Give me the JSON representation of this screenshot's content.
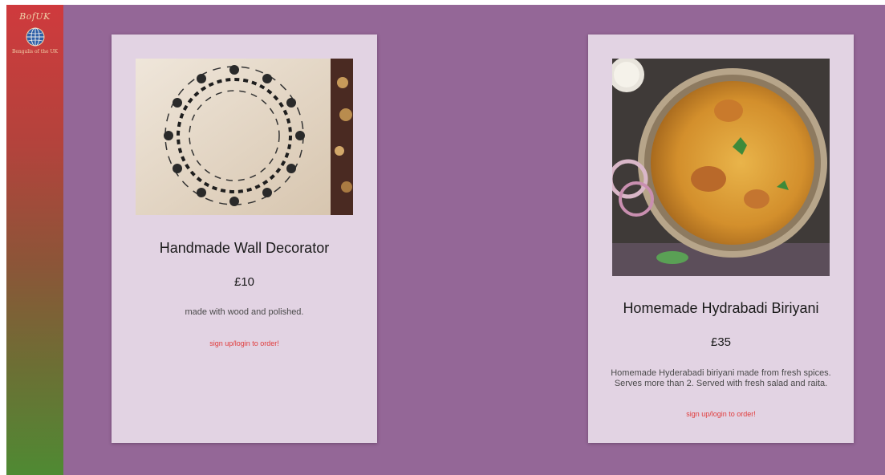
{
  "brand": {
    "logo_text": "BofUK",
    "logo_subtitle": "Bengalis of the UK"
  },
  "colors": {
    "background": "#946797",
    "card": "#e2d3e3",
    "cta": "#e03c3c",
    "sidebar_top": "#cf3a3d",
    "sidebar_bottom": "#4f8a33"
  },
  "products": [
    {
      "image": "wall-decor-image",
      "title": "Handmade Wall Decorator",
      "price": "£10",
      "description": "made with wood and polished.",
      "cta": "sign up/login to order!"
    },
    {
      "image": "biriyani-image",
      "title": "Homemade Hydrabadi Biriyani",
      "price": "£35",
      "description": "Homemade Hyderabadi biriyani made from fresh spices. Serves more than 2. Served with fresh salad and raita.",
      "cta": "sign up/login to order!"
    }
  ]
}
